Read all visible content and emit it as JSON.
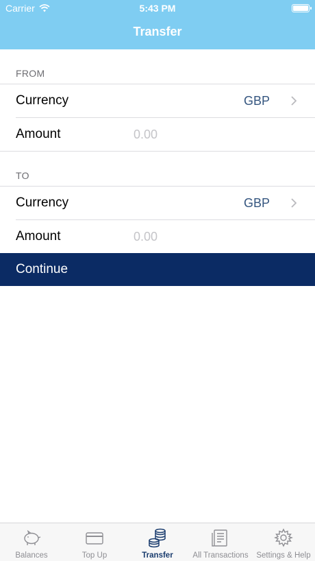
{
  "status_bar": {
    "carrier": "Carrier",
    "time": "5:43 PM"
  },
  "header": {
    "title": "Transfer"
  },
  "from": {
    "label": "FROM",
    "currency_label": "Currency",
    "currency_value": "GBP",
    "amount_label": "Amount",
    "amount_placeholder": "0.00",
    "amount_value": ""
  },
  "to": {
    "label": "TO",
    "currency_label": "Currency",
    "currency_value": "GBP",
    "amount_label": "Amount",
    "amount_placeholder": "0.00",
    "amount_value": ""
  },
  "continue_label": "Continue",
  "tabs": [
    {
      "label": "Balances",
      "icon": "piggy-bank-icon"
    },
    {
      "label": "Top Up",
      "icon": "card-icon"
    },
    {
      "label": "Transfer",
      "icon": "coins-icon",
      "active": true
    },
    {
      "label": "All Transactions",
      "icon": "receipt-icon"
    },
    {
      "label": "Settings & Help",
      "icon": "gear-icon"
    }
  ],
  "colors": {
    "header": "#7fcdf2",
    "button": "#0b2b64",
    "value_text": "#34557f",
    "active_tab": "#1a3c6e",
    "inactive_tab": "#8e8e93"
  }
}
